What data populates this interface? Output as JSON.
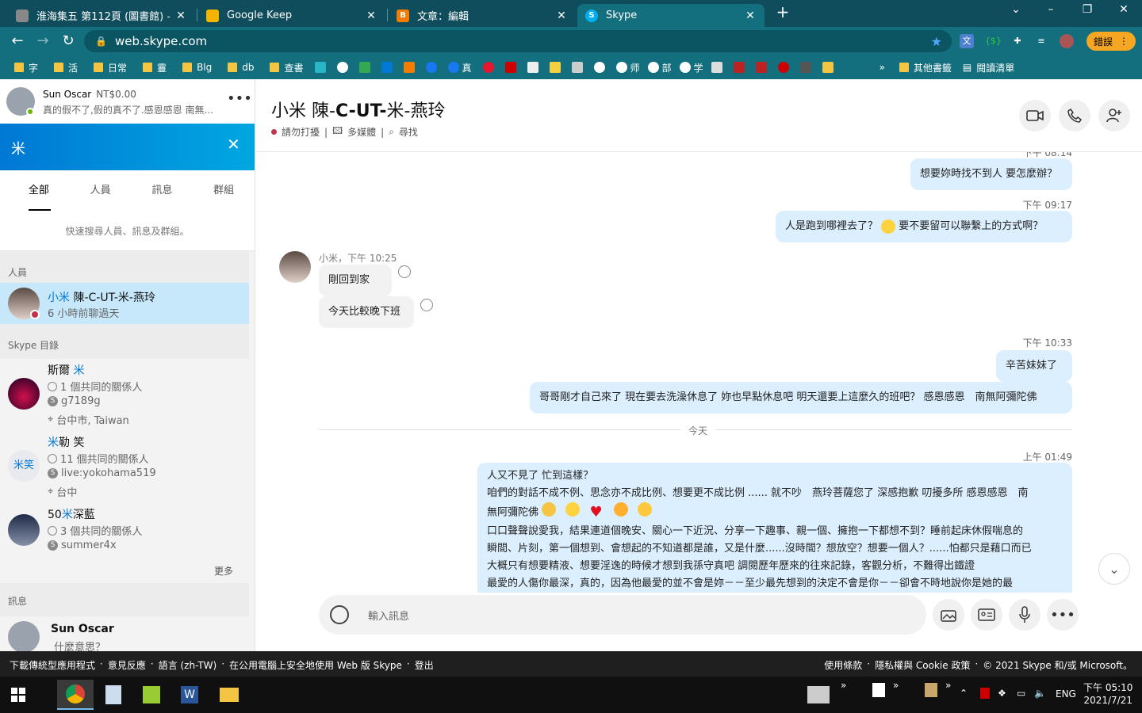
{
  "browser": {
    "tabs": [
      {
        "title": "淮海集五 第112頁 (圖書館) - 中國..."
      },
      {
        "title": "Google Keep"
      },
      {
        "title": "文章：編輯"
      },
      {
        "title": "Skype"
      }
    ],
    "new_tab": "+",
    "url": "web.skype.com",
    "error_label": "錯誤",
    "bookmarks": [
      "字",
      "活",
      "日常",
      "霻",
      "Blg",
      "db",
      "查書",
      "真",
      "师",
      "部",
      "学",
      "其他書籤",
      "閱讀清單"
    ],
    "more_bookmarks": "»"
  },
  "profile": {
    "name": "Sun Oscar",
    "balance": "NT$0.00",
    "mood": "真的假不了,假的真不了.感恩感恩 南無..."
  },
  "search": {
    "query": "米",
    "tabs": [
      "全部",
      "人員",
      "訊息",
      "群組"
    ],
    "hint": "快速搜尋人員、訊息及群組。"
  },
  "sections": {
    "people": "人員",
    "directory": "Skype 目錄",
    "more": "更多",
    "messages": "訊息"
  },
  "people": [
    {
      "name_pre": "小米",
      "name_rest": " 陳-C-UT-米-燕玲",
      "sub": "6 小時前聊過天"
    }
  ],
  "directory": [
    {
      "name_pre": "斯爾 ",
      "name_hl": "米",
      "name_post": "",
      "contacts": "1 個共同的關係人",
      "skype": "g7189g",
      "location": "台中市, Taiwan"
    },
    {
      "name_pre": "",
      "name_hl": "米",
      "name_post": "勒 笑",
      "avatar_text": "米笑",
      "contacts": "11 個共同的關係人",
      "skype": "live:yokohama519",
      "location": "台中"
    },
    {
      "name_pre": "50",
      "name_hl": "米",
      "name_post": "深藍",
      "contacts": "3 個共同的關係人",
      "skype": "summer4x",
      "location": ""
    }
  ],
  "message_result": {
    "name": "Sun Oscar",
    "text": "什麼意思？"
  },
  "chat": {
    "title_pre": "小米 陳-",
    "title_bold": "C-UT-",
    "title_post": "米-燕玲",
    "status": "請勿打擾",
    "media": "多媒體",
    "find": "尋找",
    "messages": [
      {
        "time": "下午 08:14",
        "text": "想要妳時找不到人 要怎麼辦？"
      },
      {
        "time": "下午 09:17",
        "text_a": "人是跑到哪裡去了？",
        "text_b": "要不要留可以聯繫上的方式啊？"
      },
      {
        "sender_time": "小米，下午 10:25",
        "text1": "剛回到家",
        "text2": "今天比較晚下班"
      },
      {
        "time": "下午 10:33",
        "text1": "辛苦妹妹了",
        "text2": "哥哥剛才自己來了 現在要去洗澡休息了 妳也早點休息吧 明天還要上這麼久的班吧？ 感恩感恩　南無阿彌陀佛"
      }
    ],
    "divider": "今天",
    "last_time": "上午 01:49",
    "last_lines": [
      "人又不見了 忙到這樣？",
      "咱們的對話不成不例、思念亦不成比例、想要更不成比例 ...... 就不吵　燕玲菩薩您了 深感抱歉 叨擾多所 感恩感恩　南",
      "無阿彌陀佛",
      "口口聲聲說愛我，結果連道個晚安、關心一下近況、分享一下趣事、親一個、擁抱一下都想不到？睡前起床休假喘息的",
      "瞬間、片刻，第一個想到、會想起的不知道都是誰，又是什麼......沒時間？想放空？想要一個人？......怕都只是藉口而已",
      "大概只有想要精液、想要淫逸的時候才想到我孫守真吧 調閱歷年歷來的往來記錄，客觀分析，不難得出鐵證",
      "最愛的人傷你最深，真的，因為他最愛的並不會是妳－－至少最先想到的決定不會是你－－卻會不時地說你是她的最"
    ],
    "composer_placeholder": "輸入訊息"
  },
  "footer": {
    "left": [
      "下載傳統型應用程式",
      "意見反應",
      "語言 (zh-TW)",
      "在公用電腦上安全地使用 Web 版 Skype",
      "登出"
    ],
    "right": [
      "使用條款",
      "隱私權與 Cookie 政策",
      "© 2021 Skype 和/或 Microsoft。"
    ]
  },
  "taskbar": {
    "lang": "ENG",
    "time": "下午 05:10",
    "date": "2021/7/21"
  },
  "colors": {
    "accent": "#0078d4",
    "chrome": "#136f7e",
    "bubble_out": "#dcefff"
  }
}
